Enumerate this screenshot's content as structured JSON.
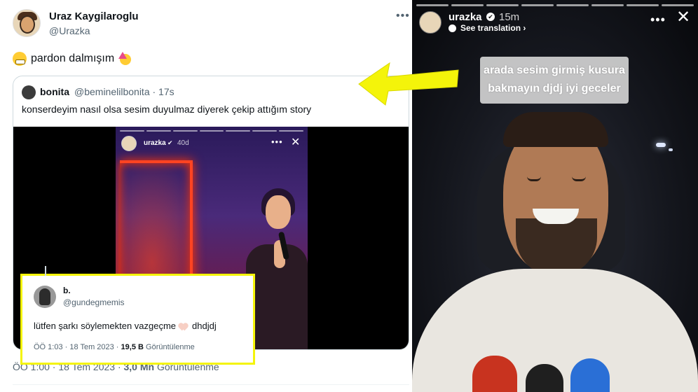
{
  "tweet": {
    "author_name": "Uraz Kaygilaroglu",
    "author_handle": "@Urazka",
    "more_label": "•••",
    "text": "pardon dalmışım",
    "quote": {
      "name": "bonita",
      "handle": "@beminelilbonita · 17s",
      "text": "konserdeyim nasıl olsa sesim duyulmaz diyerek çekip attığım story",
      "story": {
        "username": "urazka",
        "verified_label": "✔",
        "time": "40d",
        "more_label": "•••",
        "close_label": "✕"
      }
    },
    "reply": {
      "name": "b.",
      "handle": "@gundegmemis",
      "text_before": "lütfen şarkı söylemekten vazgeçme",
      "text_after": "dhdjdj",
      "meta_time": "ÖÖ 1:03 · 18 Tem 2023 ·",
      "meta_views": "19,5 B",
      "meta_views_label": "Görüntülenme"
    },
    "meta_time": "ÖÖ 1:00 · 18 Tem 2023 ·",
    "meta_views": "3,0 Mn",
    "meta_views_label": "Görüntülenme"
  },
  "story": {
    "username": "urazka",
    "verified_label": "✔",
    "time": "15m",
    "see_translation": "See translation ›",
    "more_label": "•••",
    "close_label": "✕",
    "caption_line1": "arada sesim girmiş kusura",
    "caption_line2": "bakmayın djdj iyi geceler"
  },
  "colors": {
    "highlight_yellow": "#f4f40a",
    "twitter_text": "#0f1419",
    "twitter_secondary": "#536471",
    "border": "#cfd9de"
  },
  "icons": {
    "close": "close-icon",
    "more": "more-dots-icon",
    "verified": "verified-badge-icon",
    "arrow": "yellow-arrow-icon",
    "globe": "globe-icon"
  }
}
